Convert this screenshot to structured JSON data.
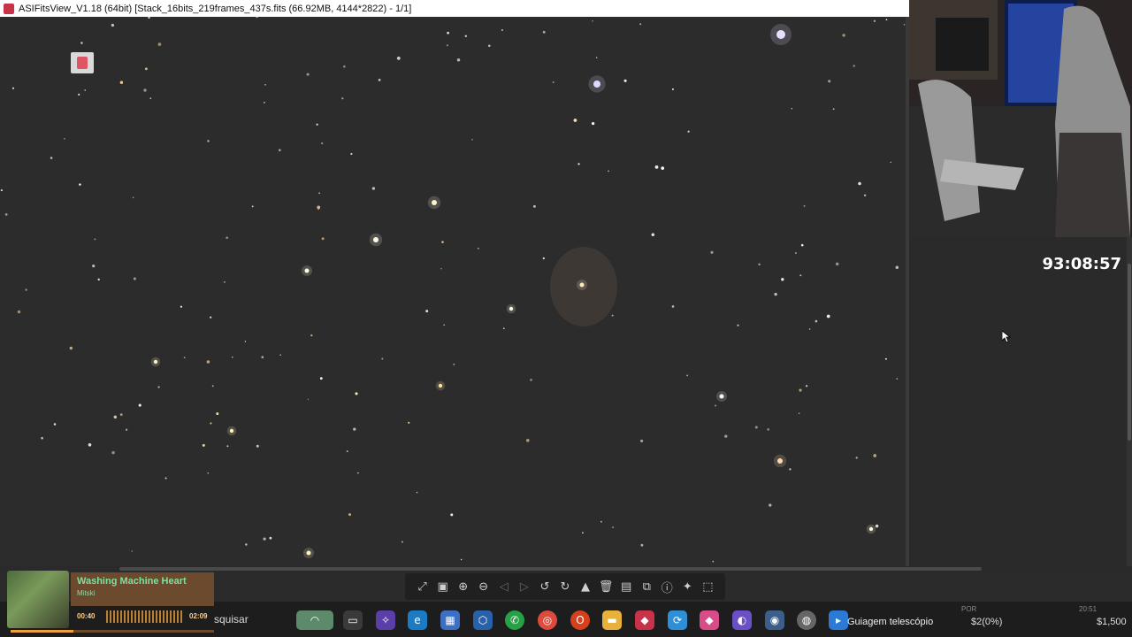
{
  "window": {
    "title": "ASIFitsView_V1.18 (64bit) [Stack_16bits_219frames_437s.fits (66.92MB, 4144*2822) - 1/1]"
  },
  "overlay": {
    "timer": "93:08:57"
  },
  "music": {
    "song": "Washing Machine Heart",
    "artist": "Mitski",
    "elapsed": "00:40",
    "total": "02:09",
    "progress": 0.31
  },
  "taskbar": {
    "search_fragment": "squisar",
    "active_label": "Guiagem telescópio",
    "ticker_1": "$2(0%)",
    "ticker_2": "$1,500",
    "tray_fragment_1": "POR",
    "tray_fragment_2": "20:51"
  },
  "toolbar": {
    "icons": [
      "fit-icon",
      "actual-size-icon",
      "zoom-in-icon",
      "zoom-out-icon",
      "prev-icon",
      "next-icon",
      "rotate-left-icon",
      "rotate-right-icon",
      "histogram-icon",
      "delete-icon",
      "save-icon",
      "crop-icon",
      "info-icon",
      "star-icon",
      "annotate-icon"
    ]
  },
  "taskbar_icons": [
    "landscape-widget",
    "file-icon",
    "copilot-icon",
    "edge-icon",
    "store-icon",
    "cube-icon",
    "whatsapp-icon",
    "chrome-icon",
    "opera-icon",
    "folder-icon",
    "asi-icon",
    "sync-icon",
    "asi-studio-icon",
    "planet-icon",
    "camera-icon",
    "saturn-icon",
    "app-icon"
  ],
  "colors": {
    "sky": "#2c2c2c",
    "accent": "#c8334a",
    "music_bg": "#6b4a2e",
    "song_text": "#7ee0a0"
  }
}
